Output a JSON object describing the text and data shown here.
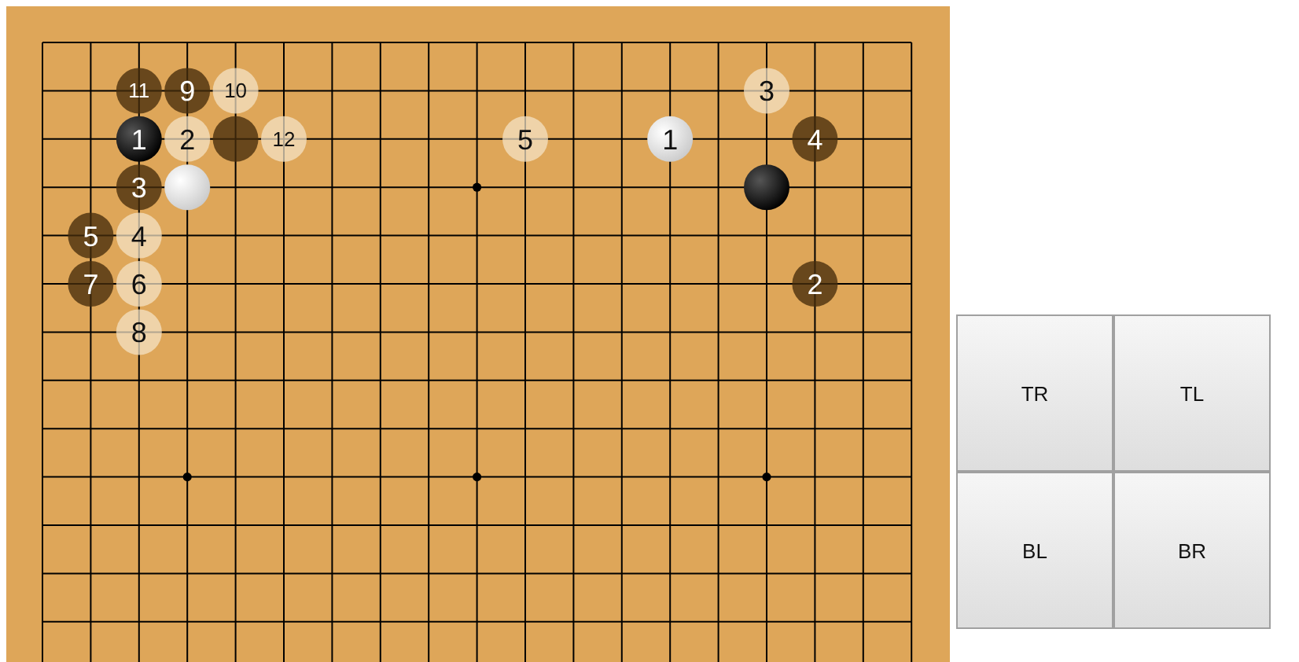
{
  "board": {
    "rows": [
      {
        "points": [
          {
            "kind": "empty"
          },
          {
            "kind": "empty"
          },
          {
            "kind": "empty"
          },
          {
            "kind": "empty"
          },
          {
            "kind": "empty"
          },
          {
            "kind": "empty"
          },
          {
            "kind": "empty"
          },
          {
            "kind": "empty"
          },
          {
            "kind": "empty"
          },
          {
            "kind": "empty"
          },
          {
            "kind": "empty"
          },
          {
            "kind": "empty"
          },
          {
            "kind": "empty"
          },
          {
            "kind": "empty"
          },
          {
            "kind": "empty"
          },
          {
            "kind": "empty"
          },
          {
            "kind": "empty"
          },
          {
            "kind": "empty"
          },
          {
            "kind": "empty"
          }
        ]
      },
      {
        "points": [
          {
            "kind": "empty"
          },
          {
            "kind": "empty"
          },
          {
            "kind": "black_ghost",
            "label": "11"
          },
          {
            "kind": "black_ghost",
            "label": "9"
          },
          {
            "kind": "white_ghost",
            "label": "10"
          },
          {
            "kind": "empty"
          },
          {
            "kind": "empty"
          },
          {
            "kind": "empty"
          },
          {
            "kind": "empty"
          },
          {
            "kind": "empty"
          },
          {
            "kind": "empty"
          },
          {
            "kind": "empty"
          },
          {
            "kind": "empty"
          },
          {
            "kind": "empty"
          },
          {
            "kind": "empty"
          },
          {
            "kind": "white_ghost",
            "label": "3"
          },
          {
            "kind": "empty"
          },
          {
            "kind": "empty"
          },
          {
            "kind": "empty"
          }
        ]
      },
      {
        "points": [
          {
            "kind": "empty"
          },
          {
            "kind": "empty"
          },
          {
            "kind": "black_stone",
            "label": "1"
          },
          {
            "kind": "white_ghost",
            "label": "2"
          },
          {
            "kind": "black_ghost"
          },
          {
            "kind": "white_ghost",
            "label": "12"
          },
          {
            "kind": "empty"
          },
          {
            "kind": "empty"
          },
          {
            "kind": "empty"
          },
          {
            "kind": "empty"
          },
          {
            "kind": "white_ghost",
            "label": "5"
          },
          {
            "kind": "empty"
          },
          {
            "kind": "empty"
          },
          {
            "kind": "white_stone",
            "label": "1"
          },
          {
            "kind": "empty"
          },
          {
            "kind": "empty"
          },
          {
            "kind": "black_ghost",
            "label": "4"
          },
          {
            "kind": "empty"
          },
          {
            "kind": "empty"
          }
        ]
      },
      {
        "points": [
          {
            "kind": "empty"
          },
          {
            "kind": "empty"
          },
          {
            "kind": "black_ghost",
            "label": "3"
          },
          {
            "kind": "white_stone"
          },
          {
            "kind": "empty"
          },
          {
            "kind": "empty"
          },
          {
            "kind": "empty"
          },
          {
            "kind": "empty"
          },
          {
            "kind": "empty"
          },
          {
            "kind": "star"
          },
          {
            "kind": "empty"
          },
          {
            "kind": "empty"
          },
          {
            "kind": "empty"
          },
          {
            "kind": "empty"
          },
          {
            "kind": "empty"
          },
          {
            "kind": "black_stone"
          },
          {
            "kind": "empty"
          },
          {
            "kind": "empty"
          },
          {
            "kind": "empty"
          }
        ]
      },
      {
        "points": [
          {
            "kind": "empty"
          },
          {
            "kind": "black_ghost",
            "label": "5"
          },
          {
            "kind": "white_ghost",
            "label": "4"
          },
          {
            "kind": "empty"
          },
          {
            "kind": "empty"
          },
          {
            "kind": "empty"
          },
          {
            "kind": "empty"
          },
          {
            "kind": "empty"
          },
          {
            "kind": "empty"
          },
          {
            "kind": "empty"
          },
          {
            "kind": "empty"
          },
          {
            "kind": "empty"
          },
          {
            "kind": "empty"
          },
          {
            "kind": "empty"
          },
          {
            "kind": "empty"
          },
          {
            "kind": "empty"
          },
          {
            "kind": "empty"
          },
          {
            "kind": "empty"
          },
          {
            "kind": "empty"
          }
        ]
      },
      {
        "points": [
          {
            "kind": "empty"
          },
          {
            "kind": "black_ghost",
            "label": "7"
          },
          {
            "kind": "white_ghost",
            "label": "6"
          },
          {
            "kind": "empty"
          },
          {
            "kind": "empty"
          },
          {
            "kind": "empty"
          },
          {
            "kind": "empty"
          },
          {
            "kind": "empty"
          },
          {
            "kind": "empty"
          },
          {
            "kind": "empty"
          },
          {
            "kind": "empty"
          },
          {
            "kind": "empty"
          },
          {
            "kind": "empty"
          },
          {
            "kind": "empty"
          },
          {
            "kind": "empty"
          },
          {
            "kind": "empty"
          },
          {
            "kind": "black_ghost",
            "label": "2"
          },
          {
            "kind": "empty"
          },
          {
            "kind": "empty"
          }
        ]
      },
      {
        "points": [
          {
            "kind": "empty"
          },
          {
            "kind": "empty"
          },
          {
            "kind": "white_ghost",
            "label": "8"
          },
          {
            "kind": "empty"
          },
          {
            "kind": "empty"
          },
          {
            "kind": "empty"
          },
          {
            "kind": "empty"
          },
          {
            "kind": "empty"
          },
          {
            "kind": "empty"
          },
          {
            "kind": "empty"
          },
          {
            "kind": "empty"
          },
          {
            "kind": "empty"
          },
          {
            "kind": "empty"
          },
          {
            "kind": "empty"
          },
          {
            "kind": "empty"
          },
          {
            "kind": "empty"
          },
          {
            "kind": "empty"
          },
          {
            "kind": "empty"
          },
          {
            "kind": "empty"
          }
        ]
      },
      {
        "points": [
          {
            "kind": "empty"
          },
          {
            "kind": "empty"
          },
          {
            "kind": "empty"
          },
          {
            "kind": "empty"
          },
          {
            "kind": "empty"
          },
          {
            "kind": "empty"
          },
          {
            "kind": "empty"
          },
          {
            "kind": "empty"
          },
          {
            "kind": "empty"
          },
          {
            "kind": "empty"
          },
          {
            "kind": "empty"
          },
          {
            "kind": "empty"
          },
          {
            "kind": "empty"
          },
          {
            "kind": "empty"
          },
          {
            "kind": "empty"
          },
          {
            "kind": "empty"
          },
          {
            "kind": "empty"
          },
          {
            "kind": "empty"
          },
          {
            "kind": "empty"
          }
        ]
      },
      {
        "points": [
          {
            "kind": "empty"
          },
          {
            "kind": "empty"
          },
          {
            "kind": "empty"
          },
          {
            "kind": "empty"
          },
          {
            "kind": "empty"
          },
          {
            "kind": "empty"
          },
          {
            "kind": "empty"
          },
          {
            "kind": "empty"
          },
          {
            "kind": "empty"
          },
          {
            "kind": "empty"
          },
          {
            "kind": "empty"
          },
          {
            "kind": "empty"
          },
          {
            "kind": "empty"
          },
          {
            "kind": "empty"
          },
          {
            "kind": "empty"
          },
          {
            "kind": "empty"
          },
          {
            "kind": "empty"
          },
          {
            "kind": "empty"
          },
          {
            "kind": "empty"
          }
        ]
      },
      {
        "points": [
          {
            "kind": "empty"
          },
          {
            "kind": "empty"
          },
          {
            "kind": "empty"
          },
          {
            "kind": "star"
          },
          {
            "kind": "empty"
          },
          {
            "kind": "empty"
          },
          {
            "kind": "empty"
          },
          {
            "kind": "empty"
          },
          {
            "kind": "empty"
          },
          {
            "kind": "star"
          },
          {
            "kind": "empty"
          },
          {
            "kind": "empty"
          },
          {
            "kind": "empty"
          },
          {
            "kind": "empty"
          },
          {
            "kind": "empty"
          },
          {
            "kind": "star"
          },
          {
            "kind": "empty"
          },
          {
            "kind": "empty"
          },
          {
            "kind": "empty"
          }
        ]
      },
      {
        "points": [
          {
            "kind": "empty"
          },
          {
            "kind": "empty"
          },
          {
            "kind": "empty"
          },
          {
            "kind": "empty"
          },
          {
            "kind": "empty"
          },
          {
            "kind": "empty"
          },
          {
            "kind": "empty"
          },
          {
            "kind": "empty"
          },
          {
            "kind": "empty"
          },
          {
            "kind": "empty"
          },
          {
            "kind": "empty"
          },
          {
            "kind": "empty"
          },
          {
            "kind": "empty"
          },
          {
            "kind": "empty"
          },
          {
            "kind": "empty"
          },
          {
            "kind": "empty"
          },
          {
            "kind": "empty"
          },
          {
            "kind": "empty"
          },
          {
            "kind": "empty"
          }
        ]
      },
      {
        "points": [
          {
            "kind": "empty"
          },
          {
            "kind": "empty"
          },
          {
            "kind": "empty"
          },
          {
            "kind": "empty"
          },
          {
            "kind": "empty"
          },
          {
            "kind": "empty"
          },
          {
            "kind": "empty"
          },
          {
            "kind": "empty"
          },
          {
            "kind": "empty"
          },
          {
            "kind": "empty"
          },
          {
            "kind": "empty"
          },
          {
            "kind": "empty"
          },
          {
            "kind": "empty"
          },
          {
            "kind": "empty"
          },
          {
            "kind": "empty"
          },
          {
            "kind": "empty"
          },
          {
            "kind": "empty"
          },
          {
            "kind": "empty"
          },
          {
            "kind": "empty"
          }
        ]
      },
      {
        "points": [
          {
            "kind": "empty"
          },
          {
            "kind": "empty"
          },
          {
            "kind": "empty"
          },
          {
            "kind": "empty"
          },
          {
            "kind": "empty"
          },
          {
            "kind": "empty"
          },
          {
            "kind": "empty"
          },
          {
            "kind": "empty"
          },
          {
            "kind": "empty"
          },
          {
            "kind": "empty"
          },
          {
            "kind": "empty"
          },
          {
            "kind": "empty"
          },
          {
            "kind": "empty"
          },
          {
            "kind": "empty"
          },
          {
            "kind": "empty"
          },
          {
            "kind": "empty"
          },
          {
            "kind": "empty"
          },
          {
            "kind": "empty"
          },
          {
            "kind": "empty"
          }
        ]
      }
    ]
  },
  "buttons": [
    "TR",
    "TL",
    "BL",
    "BR"
  ]
}
